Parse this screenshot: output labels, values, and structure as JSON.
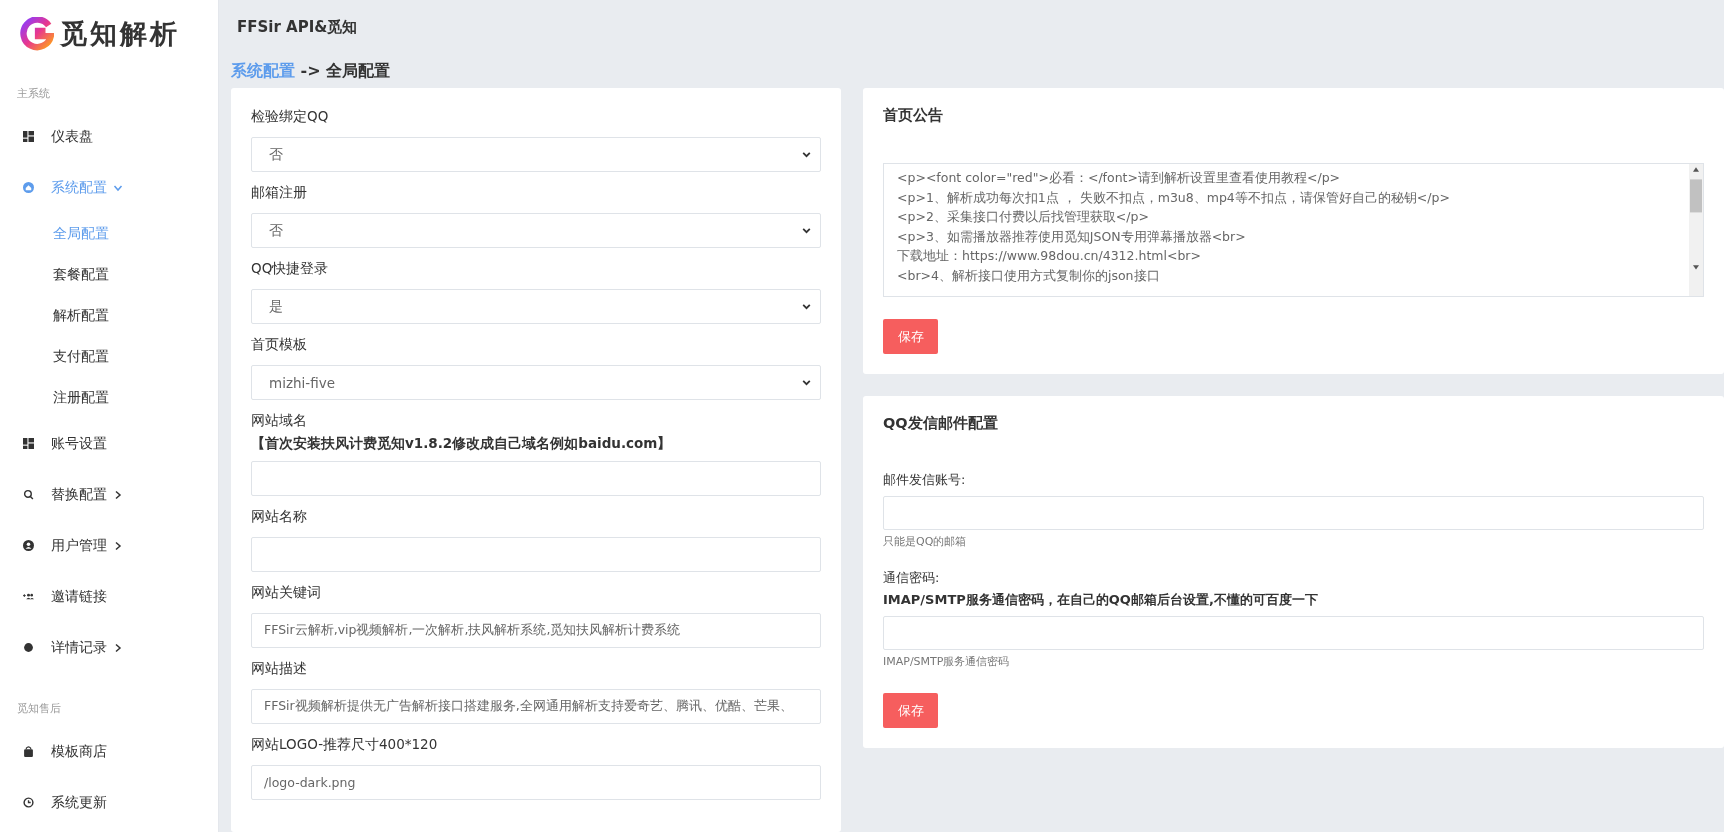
{
  "brand": {
    "name": "觅知解析"
  },
  "header": {
    "title": "FFSir API&觅知"
  },
  "sidebar": {
    "sections": [
      {
        "title": "主系统",
        "items": [
          {
            "label": "仪表盘",
            "selected": false,
            "has_arrow": false
          },
          {
            "label": "系统配置",
            "selected": true,
            "has_arrow": true,
            "expanded": true,
            "children": [
              {
                "label": "全局配置",
                "selected": true
              },
              {
                "label": "套餐配置",
                "selected": false
              },
              {
                "label": "解析配置",
                "selected": false
              },
              {
                "label": "支付配置",
                "selected": false
              },
              {
                "label": "注册配置",
                "selected": false
              }
            ]
          },
          {
            "label": "账号设置",
            "selected": false,
            "has_arrow": false
          },
          {
            "label": "替换配置",
            "selected": false,
            "has_arrow": true,
            "expanded": false
          },
          {
            "label": "用户管理",
            "selected": false,
            "has_arrow": true,
            "expanded": false
          },
          {
            "label": "邀请链接",
            "selected": false,
            "has_arrow": false
          },
          {
            "label": "详情记录",
            "selected": false,
            "has_arrow": true,
            "expanded": false
          }
        ]
      },
      {
        "title": "觅知售后",
        "items": [
          {
            "label": "模板商店",
            "selected": false,
            "has_arrow": false
          },
          {
            "label": "系统更新",
            "selected": false,
            "has_arrow": false
          }
        ]
      }
    ]
  },
  "breadcrumb": {
    "parent": "系统配置",
    "separator": "->",
    "current": "全局配置"
  },
  "global_form": {
    "fields": [
      {
        "kind": "select",
        "label": "检验绑定QQ",
        "value": "否"
      },
      {
        "kind": "select",
        "label": "邮箱注册",
        "value": "否"
      },
      {
        "kind": "select",
        "label": "QQ快捷登录",
        "value": "是"
      },
      {
        "kind": "select",
        "label": "首页模板",
        "value": "mizhi-five"
      },
      {
        "kind": "text",
        "label": "网站域名",
        "note": "【首次安装扶风计费觅知v1.8.2修改成自己域名例如baidu.com】"
      },
      {
        "kind": "text",
        "label": "网站名称"
      },
      {
        "kind": "text",
        "label": "网站关键词",
        "value": "FFSir云解析,vip视频解析,一次解析,扶风解析系统,觅知扶风解析计费系统"
      },
      {
        "kind": "text",
        "label": "网站描述",
        "value": "FFSir视频解析提供无广告解析接口搭建服务,全网通用解析支持爱奇艺、腾讯、优酷、芒果、"
      },
      {
        "kind": "text",
        "label": "网站LOGO-推荐尺寸400*120",
        "value": "/logo-dark.png"
      }
    ]
  },
  "notice_card": {
    "title": "首页公告",
    "lines": [
      "<p><font color=\"red\">必看：</font>请到解析设置里查看使用教程</p>",
      "<p>1、解析成功每次扣1点 ， 失败不扣点，m3u8、mp4等不扣点，请保管好自己的秘钥</p>",
      "<p>2、采集接口付费以后找管理获取</p>",
      "<p>3、如需播放器推荐使用觅知JSON专用弹幕播放器<br>",
      "下载地址：https://www.98dou.cn/4312.html<br>",
      "<br>4、解析接口使用方式复制你的json接口"
    ],
    "save_button": "保存"
  },
  "mail_card": {
    "title": "QQ发信邮件配置",
    "fields": [
      {
        "label": "邮件发信账号:",
        "help": "只能是QQ的邮箱"
      },
      {
        "label": "通信密码:",
        "note": "IMAP/SMTP服务通信密码，在自己的QQ邮箱后台设置,不懂的可百度一下",
        "help": "IMAP/SMTP服务通信密码"
      }
    ],
    "save_button": "保存"
  }
}
